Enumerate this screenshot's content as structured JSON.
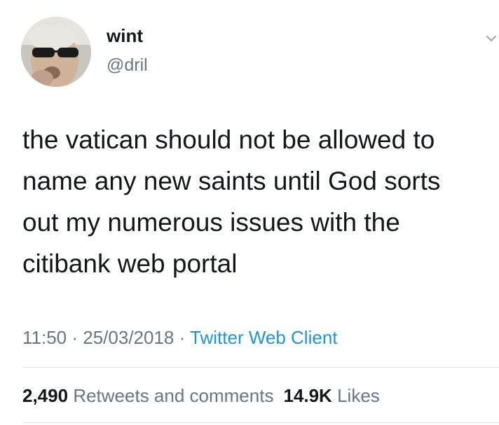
{
  "author": {
    "display_name": "wint",
    "handle": "@dril",
    "avatar": "avatar-photo-sunglasses"
  },
  "icons": {
    "caret": "chevron-down-icon"
  },
  "tweet": {
    "text": "the vatican should not be allowed to\nname any new saints until God sorts\nout my numerous issues with the\ncitibank web portal",
    "time": "11:50",
    "separator": " · ",
    "date": "25/03/2018",
    "client": "Twitter Web Client"
  },
  "stats": {
    "retweets_count": "2,490",
    "retweets_label": "Retweets and comments",
    "likes_count": "14.9K",
    "likes_label": "Likes"
  },
  "colors": {
    "text": "#14171a",
    "secondary": "#657786",
    "link": "#1b95e0",
    "divider": "#e1e8ed"
  }
}
